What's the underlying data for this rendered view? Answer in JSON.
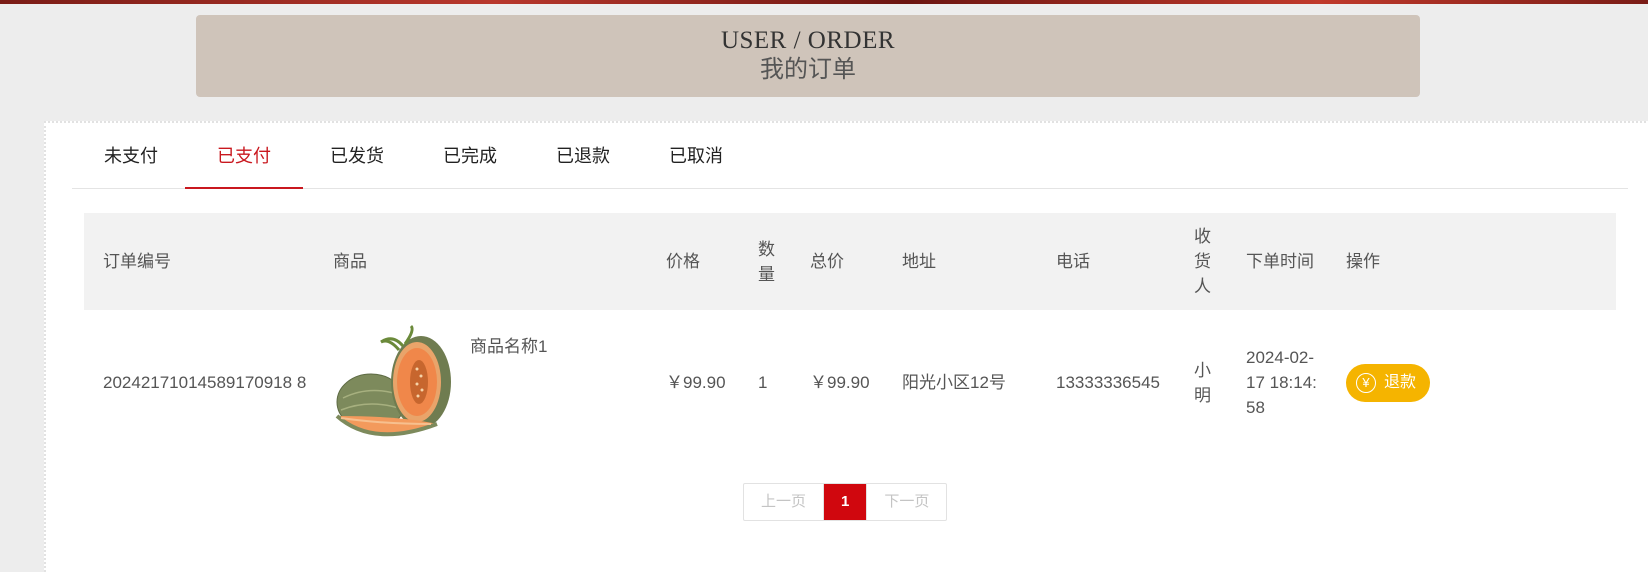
{
  "banner": {
    "title_en": "USER / ORDER",
    "title_cn": "我的订单"
  },
  "tabs": [
    {
      "label": "未支付"
    },
    {
      "label": "已支付"
    },
    {
      "label": "已发货"
    },
    {
      "label": "已完成"
    },
    {
      "label": "已退款"
    },
    {
      "label": "已取消"
    }
  ],
  "active_tab": "已支付",
  "table": {
    "headers": {
      "order_no": "订单编号",
      "product": "商品",
      "price": "价格",
      "qty": "数量",
      "total": "总价",
      "address": "地址",
      "phone": "电话",
      "receiver": "收货人",
      "time": "下单时间",
      "action": "操作"
    },
    "rows": [
      {
        "order_no": "20242171014589170918 8",
        "product_name": "商品名称1",
        "product_image": "cantaloupe-melon",
        "price": "￥99.90",
        "qty": "1",
        "total": "￥99.90",
        "address": "阳光小区12号",
        "phone": "13333336545",
        "receiver": "小明",
        "time": "2024-02-17 18:14:58",
        "action_label": "退款",
        "action_icon": "yen-icon"
      }
    ]
  },
  "pagination": {
    "prev": "上一页",
    "current": "1",
    "next": "下一页"
  },
  "colors": {
    "accent": "#c9181f",
    "refund": "#f5b400",
    "banner": "#cfc4ba"
  }
}
